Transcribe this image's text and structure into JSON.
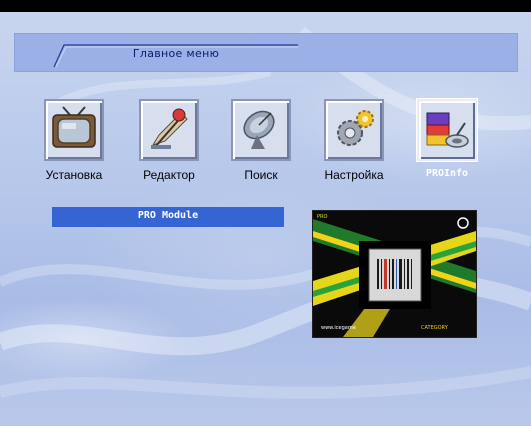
{
  "header": {
    "title": "Главное меню"
  },
  "menu": {
    "items": [
      {
        "label": "Установка",
        "icon": "tv-icon"
      },
      {
        "label": "Редактор",
        "icon": "editor-pen-icon"
      },
      {
        "label": "Поиск",
        "icon": "satellite-dish-icon"
      },
      {
        "label": "Настройка",
        "icon": "gears-icon"
      },
      {
        "label": "PROInfo",
        "icon": "pro-info-icon",
        "selected": true
      }
    ]
  },
  "module": {
    "label": "PRO Module"
  },
  "preview": {
    "top_left_text": "PRO",
    "bottom_left_text": "www.icegame",
    "bottom_right_text": "CATEGORY"
  },
  "colors": {
    "header_bar": "#9ab0e6",
    "header_text": "#0b1c6c",
    "module_bar": "#3565d2",
    "background": "#b6c7ea"
  }
}
